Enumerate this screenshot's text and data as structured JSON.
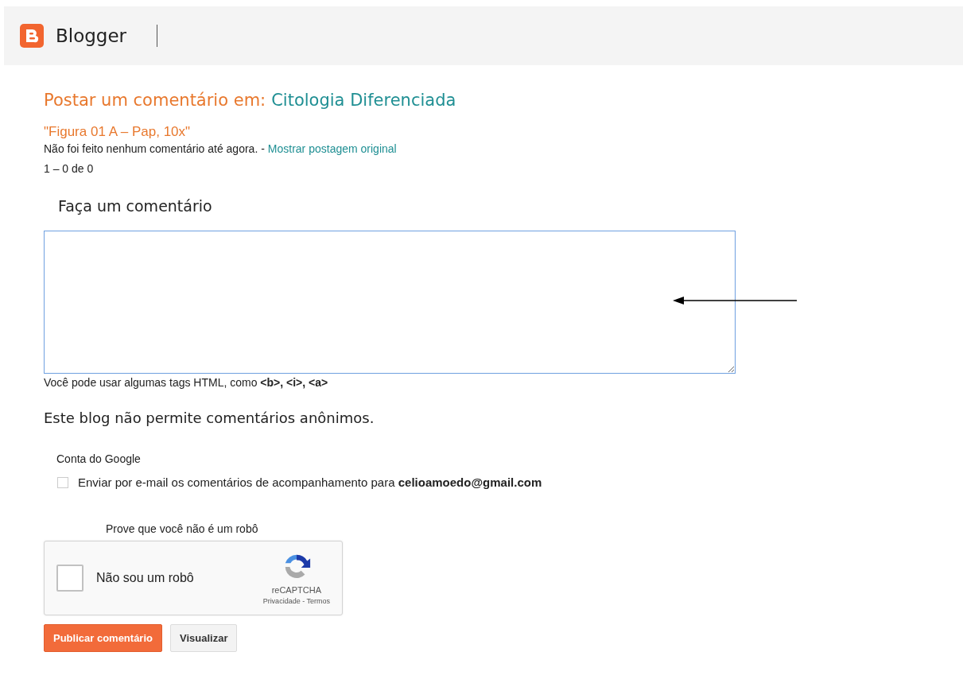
{
  "header": {
    "brand": "Blogger"
  },
  "heading": {
    "prefix": "Postar um comentário em:",
    "blog_link": "Citologia Diferenciada"
  },
  "post_title": "\"Figura 01 A – Pap, 10x\"",
  "no_comments": {
    "text": "Não foi feito nenhum comentário até agora. -",
    "link": "Mostrar postagem original"
  },
  "pager": "1 – 0 de 0",
  "comment_form": {
    "title": "Faça um comentário",
    "hint": "Você pode usar algumas tags HTML, como **<b>, <i>, <a>**"
  },
  "anonymous_notice": "Este blog não permite comentários anônimos.",
  "account": {
    "label": "Conta do Google",
    "follow_up": {
      "text": "Enviar por e-mail os comentários de acompanhamento para **celioamoedo@gmail.com**",
      "checked": false
    }
  },
  "captcha": {
    "prompt": "Prove que você não é um robô",
    "label": "Não sou um robô",
    "checked": false,
    "brand": "reCAPTCHA",
    "links": "Privacidade - Termos"
  },
  "buttons": [
    {
      "label": "Publicar comentário",
      "kind": "primary"
    },
    {
      "label": "Visualizar",
      "kind": "secondary"
    }
  ]
}
